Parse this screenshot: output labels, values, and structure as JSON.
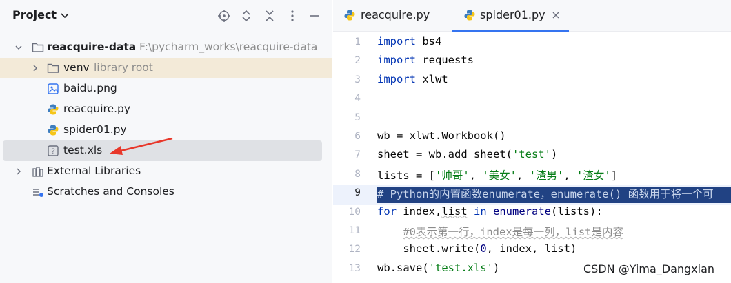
{
  "project_panel": {
    "title": "Project",
    "tree": {
      "root": {
        "name": "reacquire-data",
        "path": "F:\\pycharm_works\\reacquire-data"
      },
      "venv": {
        "name": "venv",
        "note": "library root"
      },
      "files": [
        {
          "name": "baidu.png",
          "icon": "image-file-icon"
        },
        {
          "name": "reacquire.py",
          "icon": "python-file-icon"
        },
        {
          "name": "spider01.py",
          "icon": "python-file-icon"
        },
        {
          "name": "test.xls",
          "icon": "unknown-file-icon"
        }
      ],
      "external_libraries": "External Libraries",
      "scratches": "Scratches and Consoles"
    }
  },
  "editor": {
    "tabs": [
      {
        "label": "reacquire.py",
        "active": false
      },
      {
        "label": "spider01.py",
        "active": true
      }
    ],
    "current_line": 9,
    "lines": [
      {
        "n": "1",
        "tokens": [
          [
            "kw",
            "import"
          ],
          [
            "plain",
            " bs4"
          ]
        ]
      },
      {
        "n": "2",
        "tokens": [
          [
            "kw",
            "import"
          ],
          [
            "plain",
            " requests"
          ]
        ]
      },
      {
        "n": "3",
        "tokens": [
          [
            "kw",
            "import"
          ],
          [
            "plain",
            " xlwt"
          ]
        ]
      },
      {
        "n": "4",
        "tokens": []
      },
      {
        "n": "5",
        "tokens": []
      },
      {
        "n": "6",
        "tokens": [
          [
            "plain",
            "wb = xlwt.Workbook()"
          ]
        ]
      },
      {
        "n": "7",
        "tokens": [
          [
            "plain",
            "sheet = wb.add_sheet("
          ],
          [
            "str",
            "'test'"
          ],
          [
            "plain",
            ")"
          ]
        ]
      },
      {
        "n": "8",
        "tokens": [
          [
            "plain",
            "lists = ["
          ],
          [
            "str",
            "'帅哥'"
          ],
          [
            "plain",
            ", "
          ],
          [
            "str",
            "'美女'"
          ],
          [
            "plain",
            ", "
          ],
          [
            "str",
            "'渣男'"
          ],
          [
            "plain",
            ", "
          ],
          [
            "str",
            "'渣女'"
          ],
          [
            "plain",
            "]"
          ]
        ]
      },
      {
        "n": "9",
        "tokens": [
          [
            "sel",
            "# Python的内置函数enumerate，enumerate() 函数用于将一个可"
          ]
        ]
      },
      {
        "n": "10",
        "tokens": [
          [
            "kw",
            "for"
          ],
          [
            "plain",
            " index,"
          ],
          [
            "uline",
            "list"
          ],
          [
            "plain",
            " "
          ],
          [
            "kw",
            "in"
          ],
          [
            "plain",
            " "
          ],
          [
            "bi",
            "enumerate"
          ],
          [
            "plain",
            "(lists):"
          ]
        ]
      },
      {
        "n": "11",
        "tokens": [
          [
            "plain",
            "    "
          ],
          [
            "cmtu",
            "#0表示第一行，index是每一列，list是内容"
          ]
        ]
      },
      {
        "n": "12",
        "tokens": [
          [
            "plain",
            "    sheet.write("
          ],
          [
            "bi",
            "0"
          ],
          [
            "plain",
            ", index, list)"
          ]
        ]
      },
      {
        "n": "13",
        "tokens": [
          [
            "plain",
            "wb.save("
          ],
          [
            "str",
            "'test.xls'"
          ],
          [
            "plain",
            ")"
          ]
        ]
      }
    ]
  },
  "watermark": "CSDN @Yima_Dangxian",
  "colors": {
    "accent": "#3574f0",
    "selection": "#214283",
    "keyword": "#0033b3",
    "string": "#067d17"
  }
}
